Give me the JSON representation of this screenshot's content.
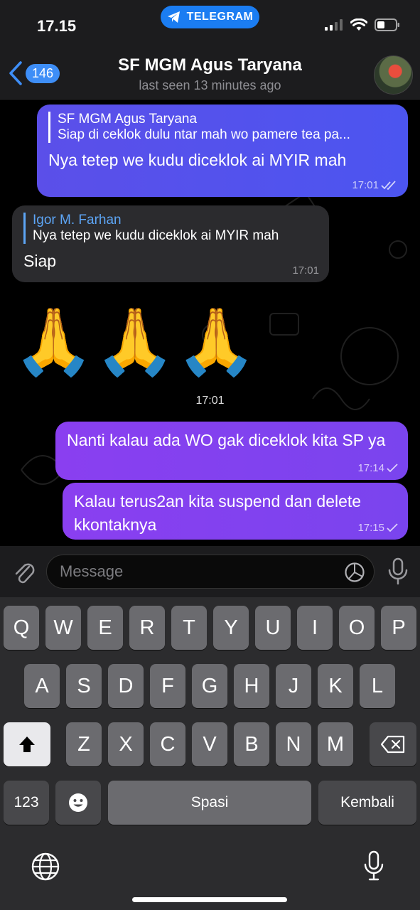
{
  "status_bar": {
    "time": "17.15",
    "app_label": "TELEGRAM",
    "icons": [
      "signal-icon",
      "wifi-icon",
      "battery-icon"
    ]
  },
  "header": {
    "back_count": "146",
    "title": "SF MGM Agus Taryana",
    "subtitle": "last seen 13 minutes ago"
  },
  "messages": [
    {
      "direction": "out",
      "reply_name": "SF MGM Agus Taryana",
      "reply_text": "Siap di ceklok dulu ntar mah wo pamere tea pa...",
      "text": "Nya tetep we kudu diceklok ai MYIR mah",
      "time": "17:01",
      "status": "read"
    },
    {
      "direction": "in",
      "reply_name": "Igor M. Farhan",
      "reply_text": "Nya tetep we kudu diceklok ai MYIR mah",
      "text": "Siap",
      "time": "17:01"
    },
    {
      "direction": "in",
      "emoji": "🙏🙏🙏",
      "time": "17:01"
    },
    {
      "direction": "out",
      "text": "Nanti kalau ada WO gak diceklok kita SP ya",
      "time": "17:14",
      "status": "sent"
    },
    {
      "direction": "out",
      "text": "Kalau terus2an kita suspend dan delete kkontaknya",
      "time": "17:15",
      "status": "sent"
    }
  ],
  "input": {
    "placeholder": "Message"
  },
  "keyboard": {
    "row1": [
      "Q",
      "W",
      "E",
      "R",
      "T",
      "Y",
      "U",
      "I",
      "O",
      "P"
    ],
    "row2": [
      "A",
      "S",
      "D",
      "F",
      "G",
      "H",
      "J",
      "K",
      "L"
    ],
    "row3": [
      "Z",
      "X",
      "C",
      "V",
      "B",
      "N",
      "M"
    ],
    "numbers_label": "123",
    "space_label": "Spasi",
    "return_label": "Kembali"
  },
  "colors": {
    "accent": "#3e8ef7",
    "out_bubble_blue": "#5050ee",
    "out_bubble_purple": "#8540f0",
    "in_bubble": "#2b2b2e",
    "keyboard_bg": "#2c2c2e"
  }
}
